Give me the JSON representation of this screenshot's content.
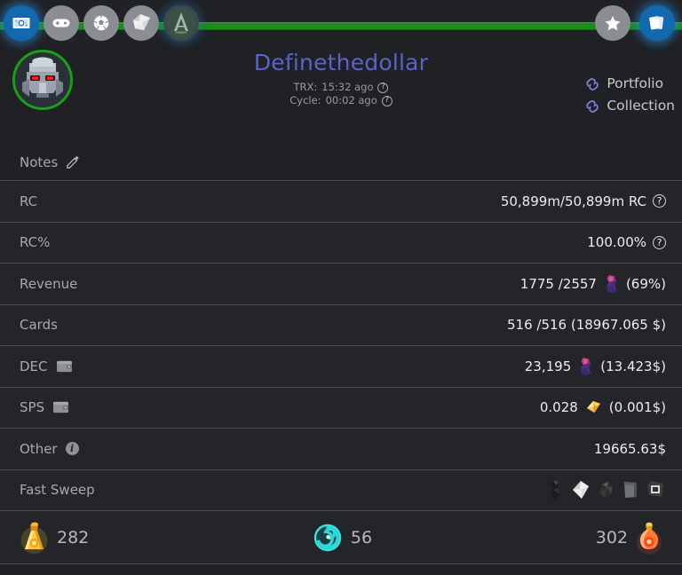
{
  "nav": {
    "left_items": [
      {
        "name": "money-icon",
        "label": "Money",
        "style": "blue"
      },
      {
        "name": "gamepad-icon",
        "label": "Battles",
        "style": "gray"
      },
      {
        "name": "soccer-ball-icon",
        "label": "Ball",
        "style": "gray"
      },
      {
        "name": "scroll-icon",
        "label": "Quests",
        "style": "gray"
      },
      {
        "name": "alpha-logo-icon",
        "label": "Alpha",
        "style": "glowdark"
      }
    ],
    "right_items": [
      {
        "name": "star-icon",
        "label": "Favorites",
        "style": "gray"
      },
      {
        "name": "cards-icon",
        "label": "Cards",
        "style": "blue"
      }
    ]
  },
  "header": {
    "username": "Definethedollar",
    "avatar_alt": "robot-avatar",
    "trx_label": "TRX:",
    "trx_value": "15:32 ago",
    "cycle_label": "Cycle:",
    "cycle_value": "00:02 ago",
    "help_glyph": "?",
    "links": [
      {
        "label": "Portfolio",
        "icon": "link-icon"
      },
      {
        "label": "Collection",
        "icon": "link-icon"
      }
    ]
  },
  "rows": [
    {
      "id": "notes",
      "label": "Notes",
      "label_icon": "edit-pencil-icon",
      "value": ""
    },
    {
      "id": "rc",
      "label": "RC",
      "label_icon": null,
      "value": "50,899m/50,899m RC",
      "value_icon": "help-icon"
    },
    {
      "id": "rc-percent",
      "label": "RC%",
      "label_icon": null,
      "value": "100.00%",
      "value_icon": "help-icon"
    },
    {
      "id": "revenue",
      "label": "Revenue",
      "label_icon": null,
      "value": "1775 /2557",
      "value_icon": "dec-gem-icon",
      "value_suffix": "(69%)"
    },
    {
      "id": "cards",
      "label": "Cards",
      "label_icon": null,
      "value": "516 /516 (18967.065 $)"
    },
    {
      "id": "dec",
      "label": "DEC",
      "label_icon": "wallet-icon",
      "value": "23,195",
      "value_icon": "dec-gem-icon",
      "value_suffix": "(13.423$)"
    },
    {
      "id": "sps",
      "label": "SPS",
      "label_icon": "wallet-icon",
      "value": "0.028",
      "value_icon": "sps-gem-icon",
      "value_suffix": "(0.001$)"
    },
    {
      "id": "other",
      "label": "Other",
      "label_icon": "info-icon",
      "value": "19665.63$"
    },
    {
      "id": "fast-sweep",
      "label": "Fast Sweep",
      "label_icon": null,
      "value": "",
      "sweep_items": [
        "glint-icon",
        "paper-icon",
        "ore-icon",
        "slab-icon",
        "frame-icon"
      ]
    }
  ],
  "footer": {
    "potions": [
      {
        "id": "legendary-potion",
        "icon": "gold-potion-icon",
        "count": "282",
        "order": "icon-first"
      },
      {
        "id": "alchemy-potion",
        "icon": "teal-spiral-icon",
        "count": "56",
        "order": "icon-first"
      },
      {
        "id": "rare-potion",
        "icon": "red-potion-icon",
        "count": "302",
        "order": "number-first"
      }
    ]
  },
  "colors": {
    "background": "#1f2124",
    "row_background": "#232528",
    "divider": "#4a4d50",
    "accent_green": "#1c8a1c",
    "accent_blue": "#1269b0",
    "username": "#5a63c9",
    "link": "#7b82d8"
  }
}
